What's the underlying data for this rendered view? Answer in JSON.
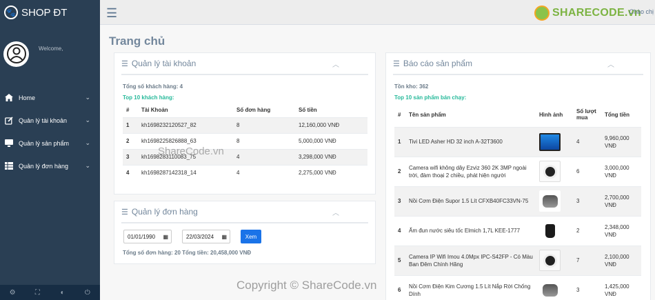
{
  "sidebar": {
    "brand": "SHOP ĐT",
    "welcome": "Welcome,",
    "items": [
      {
        "label": "Home",
        "icon": "home-icon"
      },
      {
        "label": "Quản lý tài khoản",
        "icon": "edit-icon"
      },
      {
        "label": "Quản lý sản phẩm",
        "icon": "desktop-icon"
      },
      {
        "label": "Quản lý đơn hàng",
        "icon": "table-icon"
      }
    ],
    "footer_icons": [
      "gear-icon",
      "fullscreen-icon",
      "eye-slash-icon",
      "power-icon"
    ]
  },
  "topnav": {
    "greeting": "Chào chị",
    "watermark": "SHARECODE.vn"
  },
  "page_title": "Trang chủ",
  "accounts": {
    "title": "Quản lý tài khoản",
    "total_customers": "Tổng số khách hàng: 4",
    "top10_label": "Top 10 khách hàng:",
    "columns": [
      "#",
      "Tài Khoản",
      "Số đơn hàng",
      "Số tiền"
    ],
    "rows": [
      [
        "1",
        "kh1698232120527_82",
        "8",
        "12,160,000 VNĐ"
      ],
      [
        "2",
        "kh1698225826888_63",
        "8",
        "5,000,000 VNĐ"
      ],
      [
        "3",
        "kh1698283110083_75",
        "4",
        "3,298,000 VNĐ"
      ],
      [
        "4",
        "kh1698287142318_14",
        "4",
        "2,275,000 VNĐ"
      ]
    ]
  },
  "orders": {
    "title": "Quản lý đơn hàng",
    "from_date": "01/01/1990",
    "to_date": "22/03/2024",
    "view_button": "Xem",
    "summary": "Tổng số đơn hàng: 20 Tổng tiền: 20,458,000 VNĐ"
  },
  "products": {
    "title": "Báo cáo sản phẩm",
    "stock": "Tồn kho: 362",
    "top10_label": "Top 10 sản phẩm bán chạy:",
    "columns": [
      "#",
      "Tên sản phẩm",
      "Hình ảnh",
      "Số lượt mua",
      "Tổng tiền"
    ],
    "rows": [
      {
        "no": "1",
        "name": "Tivi LED Asher HD 32 inch A-32T3600",
        "img": "tv",
        "qty": "4",
        "total": "9,960,000 VNĐ"
      },
      {
        "no": "2",
        "name": "Camera wifi không dây Ezviz 360 2K 3MP ngoài trời, đàm thoại 2 chiều, phát hiện người",
        "img": "cam",
        "qty": "6",
        "total": "3,000,000 VNĐ"
      },
      {
        "no": "3",
        "name": "Nồi Cơm Điện Supor 1.5 Lít CFXB40FC33VN-75",
        "img": "pot",
        "qty": "3",
        "total": "2,700,000 VNĐ"
      },
      {
        "no": "4",
        "name": "Ấm đun nước siêu tốc Elmich 1,7L KEE-1777",
        "img": "kettle",
        "qty": "2",
        "total": "2,348,000 VNĐ"
      },
      {
        "no": "5",
        "name": "Camera IP Wifi Imou 4.0Mpx IPC-S42FP - Có Màu Ban Đêm Chính Hãng",
        "img": "cam",
        "qty": "7",
        "total": "2,100,000 VNĐ"
      },
      {
        "no": "6",
        "name": "Nồi Cơm Điện Kim Cương 1.5 Lít Nắp Rời Chống Dính",
        "img": "pot",
        "qty": "3",
        "total": "1,425,000 VNĐ"
      }
    ]
  },
  "watermarks": {
    "center": "ShareCode.vn",
    "bottom": "Copyright © ShareCode.vn"
  }
}
